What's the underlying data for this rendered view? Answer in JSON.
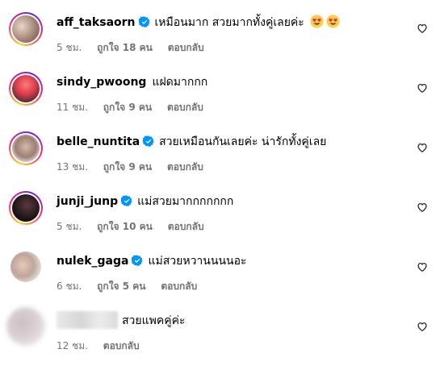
{
  "comments": [
    {
      "username": "aff_taksaorn",
      "verified": true,
      "text": "เหมือนมาก สวยมากทั้งคู่เลยค่ะ",
      "emoji": [
        "heart-eyes-emoji",
        "heart-eyes-emoji"
      ],
      "time": "5 ชม.",
      "likes": "ถูกใจ 18 คน",
      "reply": "ตอบกลับ"
    },
    {
      "username": "sindy_pwoong",
      "verified": false,
      "text": "แฝดมากกก",
      "time": "11 ชม.",
      "likes": "ถูกใจ 9 คน",
      "reply": "ตอบกลับ"
    },
    {
      "username": "belle_nuntita",
      "verified": true,
      "text": "สวยเหมือนกันเลยค่ะ น่ารักทั้งคู่เลย",
      "time": "13 ชม.",
      "likes": "ถูกใจ 9 คน",
      "reply": "ตอบกลับ"
    },
    {
      "username": "junji_junp",
      "verified": true,
      "text": "แม่สวยมากกกกกกก",
      "time": "5 ชม.",
      "likes": "ถูกใจ 10 คน",
      "reply": "ตอบกลับ"
    },
    {
      "username": "nulek_gaga",
      "verified": true,
      "text": "แม่สวยหวานนนนอะ",
      "time": "6 ชม.",
      "likes": "ถูกใจ 5 คน",
      "reply": "ตอบกลับ"
    },
    {
      "username": "",
      "verified": false,
      "text": "สวยแพคคู่ค่ะ",
      "time": "12 ชม.",
      "reply": "ตอบกลับ"
    }
  ],
  "colors": {
    "verified": "#0095f6",
    "meta": "#737373"
  },
  "icons": {
    "like": "heart-outline-icon",
    "verified": "verified-badge-icon"
  }
}
